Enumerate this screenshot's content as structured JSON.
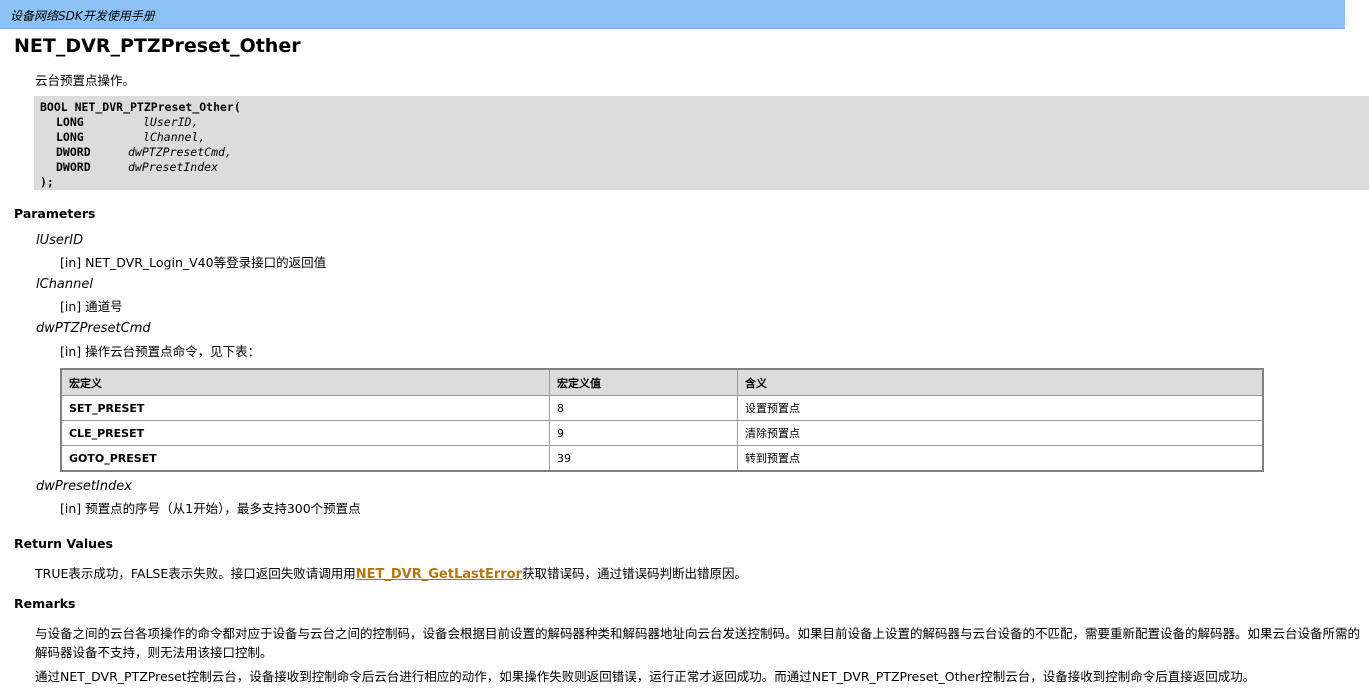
{
  "header": {
    "title": "设备网络SDK开发使用手册"
  },
  "page_title": "NET_DVR_PTZPreset_Other",
  "summary": "云台预置点操作。",
  "code": {
    "line1": "BOOL NET_DVR_PTZPreset_Other(",
    "params": [
      {
        "type": "LONG",
        "name": "lUserID,"
      },
      {
        "type": "LONG",
        "name": "lChannel,"
      },
      {
        "type": "DWORD",
        "name": "dwPTZPresetCmd,"
      },
      {
        "type": "DWORD",
        "name": "dwPresetIndex"
      }
    ],
    "close": ");"
  },
  "sections": {
    "parameters": "Parameters",
    "return_values": "Return Values",
    "remarks": "Remarks"
  },
  "params": [
    {
      "name": "lUserID",
      "desc": "[in] NET_DVR_Login_V40等登录接口的返回值"
    },
    {
      "name": "lChannel",
      "desc": "[in] 通道号"
    },
    {
      "name": "dwPTZPresetCmd",
      "desc": "[in] 操作云台预置点命令，见下表："
    },
    {
      "name": "dwPresetIndex",
      "desc": "[in] 预置点的序号（从1开始），最多支持300个预置点"
    }
  ],
  "table": {
    "headers": [
      "宏定义",
      "宏定义值",
      "含义"
    ],
    "rows": [
      [
        "SET_PRESET",
        "8",
        "设置预置点"
      ],
      [
        "CLE_PRESET",
        "9",
        "清除预置点"
      ],
      [
        "GOTO_PRESET",
        "39",
        "转到预置点"
      ]
    ]
  },
  "return_text": {
    "before": "TRUE表示成功，FALSE表示失败。接口返回失败请调用用",
    "link": "NET_DVR_GetLastError",
    "after": "获取错误码，通过错误码判断出错原因。"
  },
  "remarks": {
    "p1": "与设备之间的云台各项操作的命令都对应于设备与云台之间的控制码，设备会根据目前设置的解码器种类和解码器地址向云台发送控制码。如果目前设备上设置的解码器与云台设备的不匹配，需要重新配置设备的解码器。如果云台设备所需的解码器设备不支持，则无法用该接口控制。",
    "p2": "通过NET_DVR_PTZPreset控制云台，设备接收到控制命令后云台进行相应的动作，如果操作失败则返回错误，运行正常才返回成功。而通过NET_DVR_PTZPreset_Other控制云台，设备接收到控制命令后直接返回成功。"
  }
}
